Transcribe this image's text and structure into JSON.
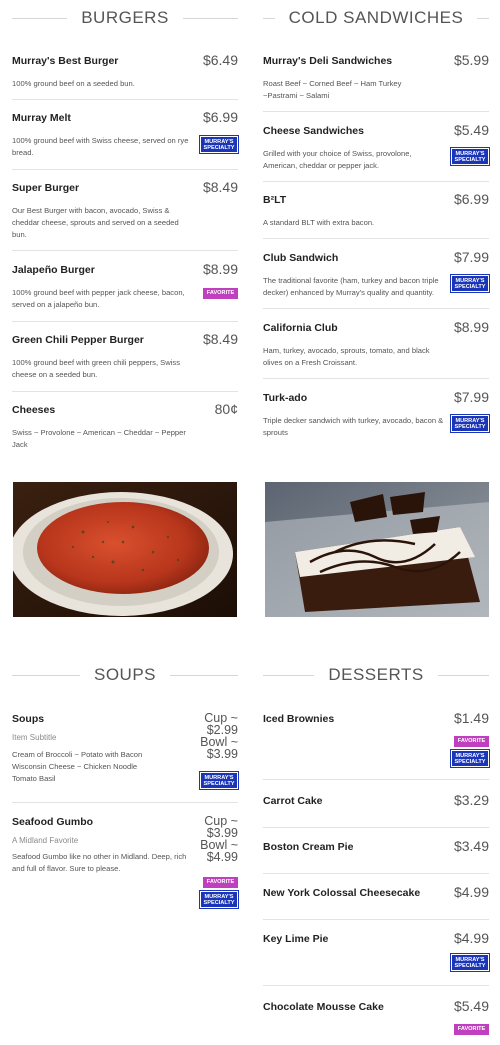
{
  "sections": {
    "burgers": {
      "title": "BURGERS",
      "items": [
        {
          "name": "Murray's Best Burger",
          "price": "$6.49",
          "desc": "100% ground beef on a seeded bun."
        },
        {
          "name": "Murray Melt",
          "price": "$6.99",
          "desc": "100% ground beef with Swiss cheese, served on rye bread.",
          "badge": "MURRAY'S SPECIALTY"
        },
        {
          "name": "Super Burger",
          "price": "$8.49",
          "desc": "Our Best Burger with bacon, avocado, Swiss & cheddar cheese, sprouts and served on a seeded bun."
        },
        {
          "name": "Jalapeño Burger",
          "price": "$8.99",
          "desc": "100% ground beef with pepper jack cheese, bacon, served on a jalapeño bun.",
          "badge": "FAVORITE"
        },
        {
          "name": "Green Chili Pepper Burger",
          "price": "$8.49",
          "desc": "100% ground beef with green chili peppers, Swiss cheese on a seeded bun."
        },
        {
          "name": "Cheeses",
          "price": "80¢",
          "desc": "Swiss ~ Provolone ~ American ~ Cheddar ~ Pepper Jack"
        }
      ]
    },
    "cold_sandwiches": {
      "title": "COLD SANDWICHES",
      "items": [
        {
          "name": "Murray's Deli Sandwiches",
          "price": "$5.99",
          "desc": "Roast Beef ~ Corned Beef ~ Ham Turkey ~Pastrami ~ Salami"
        },
        {
          "name": "Cheese Sandwiches",
          "price": "$5.49",
          "desc": "Grilled with your choice of Swiss, provolone, American, cheddar or pepper jack.",
          "badge": "MURRAY'S SPECIALTY"
        },
        {
          "name": "B²LT",
          "price": "$6.99",
          "desc": "A standard BLT with extra bacon."
        },
        {
          "name": "Club Sandwich",
          "price": "$7.99",
          "desc": "The traditional favorite (ham, turkey and bacon triple decker) enhanced by Murray's quality and quantity.",
          "badge": "MURRAY'S SPECIALTY"
        },
        {
          "name": "California Club",
          "price": "$8.99",
          "desc": "Ham, turkey, avocado, sprouts, tomato, and black olives on a Fresh Croissant."
        },
        {
          "name": "Turk-ado",
          "price": "$7.99",
          "desc": "Triple decker sandwich with turkey, avocado, bacon & sprouts",
          "badge": "MURRAY'S SPECIALTY"
        }
      ]
    },
    "soups": {
      "title": "SOUPS",
      "items": [
        {
          "name": "Soups",
          "subtitle": "Item Subtitle",
          "price_lines": [
            "Cup ~",
            "$2.99",
            "Bowl ~",
            "$3.99"
          ],
          "desc": "Cream of Broccoli ~ Potato with Bacon Wisconsin Cheese ~ Chicken Noodle Tomato Basil",
          "badges": [
            "MURRAY'S SPECIALTY"
          ]
        },
        {
          "name": "Seafood Gumbo",
          "subtitle": "A Midland Favorite",
          "price_lines": [
            "Cup ~",
            "$3.99",
            "Bowl ~",
            "$4.99"
          ],
          "desc": "Seafood Gumbo like no other in Midland. Deep, rich and full of flavor. Sure to please.",
          "badges": [
            "FAVORITE",
            "MURRAY'S SPECIALTY"
          ]
        }
      ]
    },
    "desserts": {
      "title": "DESSERTS",
      "items": [
        {
          "name": "Iced Brownies",
          "price": "$1.49",
          "badges": [
            "FAVORITE",
            "MURRAY'S SPECIALTY"
          ]
        },
        {
          "name": "Carrot Cake",
          "price": "$3.29"
        },
        {
          "name": "Boston Cream Pie",
          "price": "$3.49"
        },
        {
          "name": "New York Colossal Cheesecake",
          "price": "$4.99"
        },
        {
          "name": "Key Lime Pie",
          "price": "$4.99",
          "badges": [
            "MURRAY'S SPECIALTY"
          ]
        },
        {
          "name": "Chocolate Mousse Cake",
          "price": "$5.49",
          "badges": [
            "FAVORITE"
          ]
        }
      ]
    }
  },
  "images": {
    "soup": {
      "icon": "soup-bowl-photo"
    },
    "dessert": {
      "icon": "chocolate-cake-photo"
    }
  },
  "colors": {
    "specialty_badge": "#1a35b8",
    "favorite_badge": "#c03fbe",
    "divider": "#e3e3e3"
  }
}
